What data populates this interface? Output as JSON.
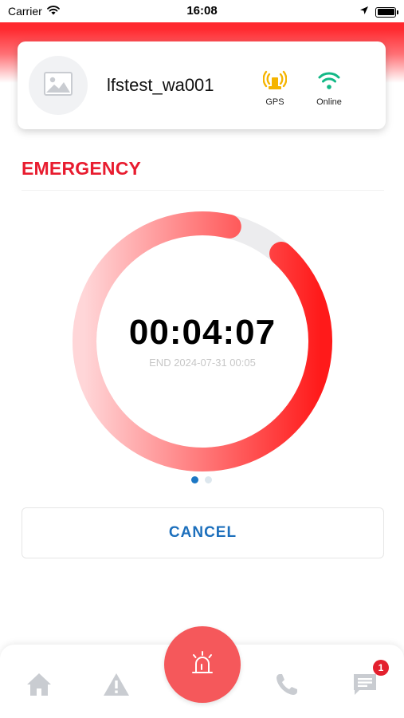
{
  "status_bar": {
    "carrier": "Carrier",
    "time": "16:08",
    "wifi_icon": "wifi-icon",
    "location_icon": "location-arrow-icon",
    "battery_icon": "battery-full-icon"
  },
  "profile": {
    "username": "lfstest_wa001",
    "avatar_icon": "image-placeholder-icon",
    "gps": {
      "label": "GPS",
      "icon": "gps-antenna-icon",
      "color": "#f5b400"
    },
    "online": {
      "label": "Online",
      "icon": "wifi-icon",
      "color": "#12b886"
    }
  },
  "emergency": {
    "title": "EMERGENCY",
    "title_color": "#e81c2f",
    "timer": "00:04:07",
    "end_label": "END 2024-07-31 00:05",
    "progress": 0.92,
    "ring_start_color": "#ffd6d8",
    "ring_end_color": "#ff1a1a",
    "ring_track_color": "#ececee"
  },
  "pager": {
    "count": 2,
    "active": 0
  },
  "cancel": {
    "label": "CANCEL",
    "color": "#1c6fbc"
  },
  "nav": {
    "home_icon": "home-icon",
    "alert_icon": "warning-triangle-icon",
    "sos_icon": "siren-icon",
    "phone_icon": "phone-icon",
    "message_icon": "message-icon",
    "message_badge": "1",
    "sos_color": "#f5585b"
  }
}
